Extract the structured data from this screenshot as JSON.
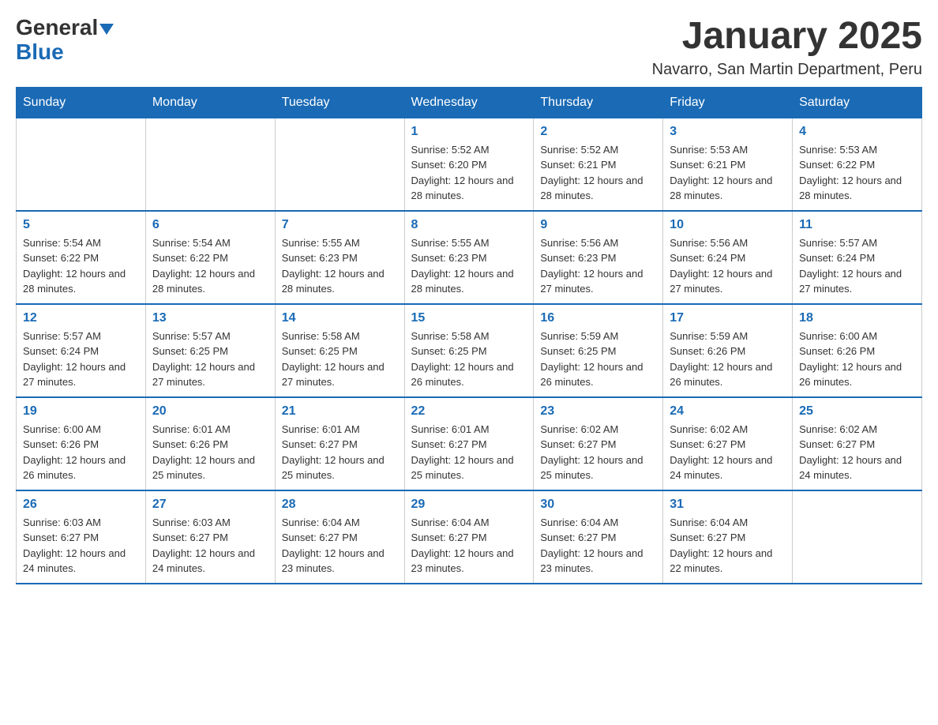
{
  "logo": {
    "text1": "General",
    "text2": "Blue"
  },
  "title": "January 2025",
  "subtitle": "Navarro, San Martin Department, Peru",
  "days_of_week": [
    "Sunday",
    "Monday",
    "Tuesday",
    "Wednesday",
    "Thursday",
    "Friday",
    "Saturday"
  ],
  "weeks": [
    [
      {
        "day": "",
        "info": ""
      },
      {
        "day": "",
        "info": ""
      },
      {
        "day": "",
        "info": ""
      },
      {
        "day": "1",
        "info": "Sunrise: 5:52 AM\nSunset: 6:20 PM\nDaylight: 12 hours and 28 minutes."
      },
      {
        "day": "2",
        "info": "Sunrise: 5:52 AM\nSunset: 6:21 PM\nDaylight: 12 hours and 28 minutes."
      },
      {
        "day": "3",
        "info": "Sunrise: 5:53 AM\nSunset: 6:21 PM\nDaylight: 12 hours and 28 minutes."
      },
      {
        "day": "4",
        "info": "Sunrise: 5:53 AM\nSunset: 6:22 PM\nDaylight: 12 hours and 28 minutes."
      }
    ],
    [
      {
        "day": "5",
        "info": "Sunrise: 5:54 AM\nSunset: 6:22 PM\nDaylight: 12 hours and 28 minutes."
      },
      {
        "day": "6",
        "info": "Sunrise: 5:54 AM\nSunset: 6:22 PM\nDaylight: 12 hours and 28 minutes."
      },
      {
        "day": "7",
        "info": "Sunrise: 5:55 AM\nSunset: 6:23 PM\nDaylight: 12 hours and 28 minutes."
      },
      {
        "day": "8",
        "info": "Sunrise: 5:55 AM\nSunset: 6:23 PM\nDaylight: 12 hours and 28 minutes."
      },
      {
        "day": "9",
        "info": "Sunrise: 5:56 AM\nSunset: 6:23 PM\nDaylight: 12 hours and 27 minutes."
      },
      {
        "day": "10",
        "info": "Sunrise: 5:56 AM\nSunset: 6:24 PM\nDaylight: 12 hours and 27 minutes."
      },
      {
        "day": "11",
        "info": "Sunrise: 5:57 AM\nSunset: 6:24 PM\nDaylight: 12 hours and 27 minutes."
      }
    ],
    [
      {
        "day": "12",
        "info": "Sunrise: 5:57 AM\nSunset: 6:24 PM\nDaylight: 12 hours and 27 minutes."
      },
      {
        "day": "13",
        "info": "Sunrise: 5:57 AM\nSunset: 6:25 PM\nDaylight: 12 hours and 27 minutes."
      },
      {
        "day": "14",
        "info": "Sunrise: 5:58 AM\nSunset: 6:25 PM\nDaylight: 12 hours and 27 minutes."
      },
      {
        "day": "15",
        "info": "Sunrise: 5:58 AM\nSunset: 6:25 PM\nDaylight: 12 hours and 26 minutes."
      },
      {
        "day": "16",
        "info": "Sunrise: 5:59 AM\nSunset: 6:25 PM\nDaylight: 12 hours and 26 minutes."
      },
      {
        "day": "17",
        "info": "Sunrise: 5:59 AM\nSunset: 6:26 PM\nDaylight: 12 hours and 26 minutes."
      },
      {
        "day": "18",
        "info": "Sunrise: 6:00 AM\nSunset: 6:26 PM\nDaylight: 12 hours and 26 minutes."
      }
    ],
    [
      {
        "day": "19",
        "info": "Sunrise: 6:00 AM\nSunset: 6:26 PM\nDaylight: 12 hours and 26 minutes."
      },
      {
        "day": "20",
        "info": "Sunrise: 6:01 AM\nSunset: 6:26 PM\nDaylight: 12 hours and 25 minutes."
      },
      {
        "day": "21",
        "info": "Sunrise: 6:01 AM\nSunset: 6:27 PM\nDaylight: 12 hours and 25 minutes."
      },
      {
        "day": "22",
        "info": "Sunrise: 6:01 AM\nSunset: 6:27 PM\nDaylight: 12 hours and 25 minutes."
      },
      {
        "day": "23",
        "info": "Sunrise: 6:02 AM\nSunset: 6:27 PM\nDaylight: 12 hours and 25 minutes."
      },
      {
        "day": "24",
        "info": "Sunrise: 6:02 AM\nSunset: 6:27 PM\nDaylight: 12 hours and 24 minutes."
      },
      {
        "day": "25",
        "info": "Sunrise: 6:02 AM\nSunset: 6:27 PM\nDaylight: 12 hours and 24 minutes."
      }
    ],
    [
      {
        "day": "26",
        "info": "Sunrise: 6:03 AM\nSunset: 6:27 PM\nDaylight: 12 hours and 24 minutes."
      },
      {
        "day": "27",
        "info": "Sunrise: 6:03 AM\nSunset: 6:27 PM\nDaylight: 12 hours and 24 minutes."
      },
      {
        "day": "28",
        "info": "Sunrise: 6:04 AM\nSunset: 6:27 PM\nDaylight: 12 hours and 23 minutes."
      },
      {
        "day": "29",
        "info": "Sunrise: 6:04 AM\nSunset: 6:27 PM\nDaylight: 12 hours and 23 minutes."
      },
      {
        "day": "30",
        "info": "Sunrise: 6:04 AM\nSunset: 6:27 PM\nDaylight: 12 hours and 23 minutes."
      },
      {
        "day": "31",
        "info": "Sunrise: 6:04 AM\nSunset: 6:27 PM\nDaylight: 12 hours and 22 minutes."
      },
      {
        "day": "",
        "info": ""
      }
    ]
  ]
}
